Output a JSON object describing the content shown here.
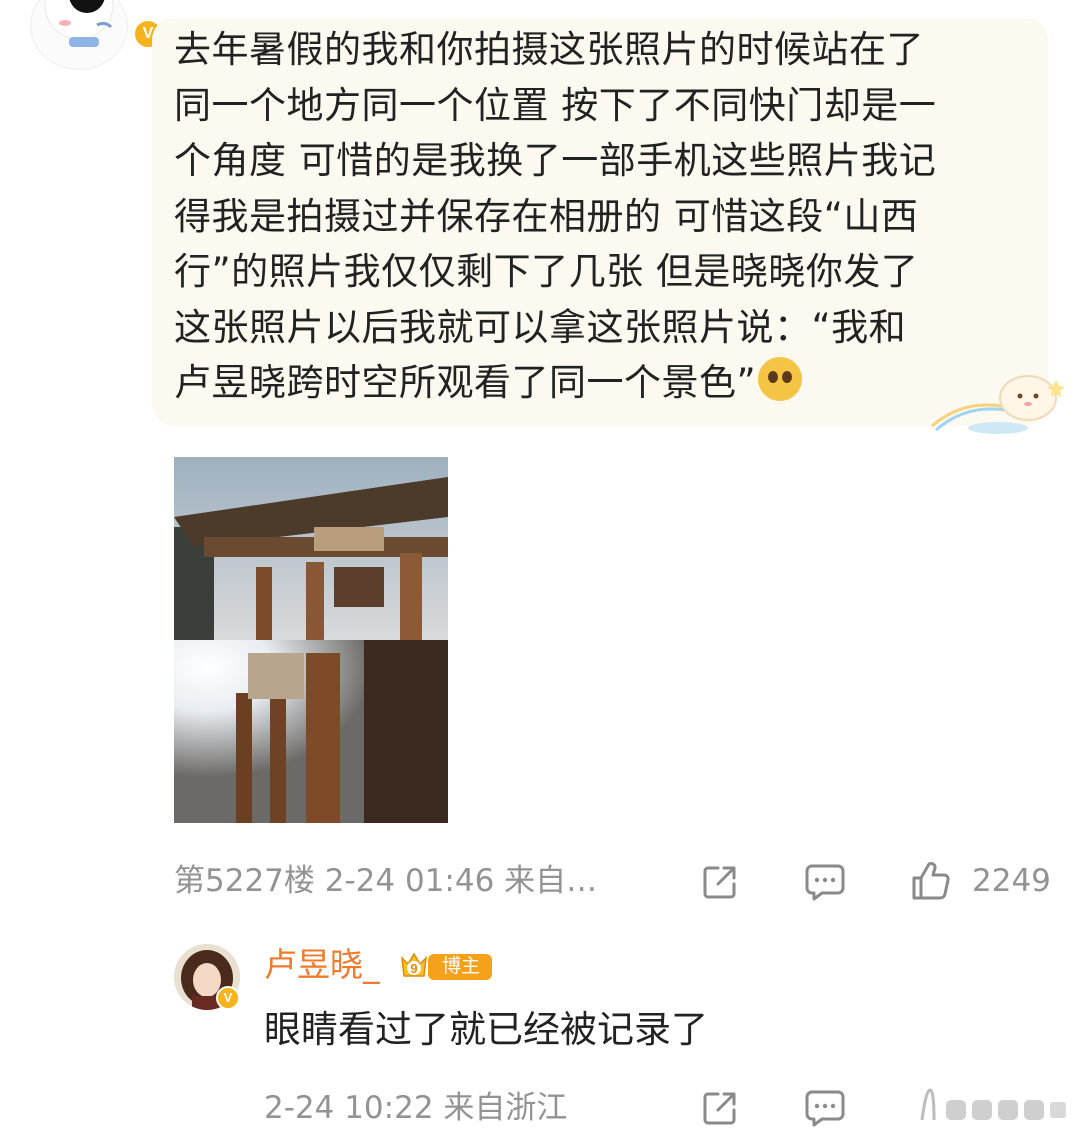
{
  "comment": {
    "text_lines": [
      "去年暑假的我和你拍摄这张照片的时候站在了",
      "同一个地方同一个位置 按下了不同快门却是一",
      "个角度 可惜的是我换了一部手机这些照片我记",
      "得我是拍摄过并保存在相册的 可惜这段“山西",
      "行”的照片我仅仅剩下了几张 但是晓晓你发了",
      "这张照片以后我就可以拿这张照片说：“我和",
      "卢昱晓跨时空所观看了同一个景色”"
    ],
    "emoji": "pleading-face-emoji",
    "floor": "第5227楼",
    "time": "2-24 01:46",
    "source": "来自…",
    "like_count": "2249"
  },
  "reply": {
    "author": "卢昱晓_",
    "badge": "博主",
    "badge_number": "9",
    "text": "眼睛看过了就已经被记录了",
    "time": "2-24 10:22",
    "source": "来自浙江"
  },
  "verified_mark": "V",
  "colors": {
    "bubble_bg": "#fbf9f0",
    "meta_gray": "#939393",
    "author_orange": "#ed7b2f",
    "verified_gold": "#f6b31b",
    "badge_orange": "#f6a11b"
  }
}
